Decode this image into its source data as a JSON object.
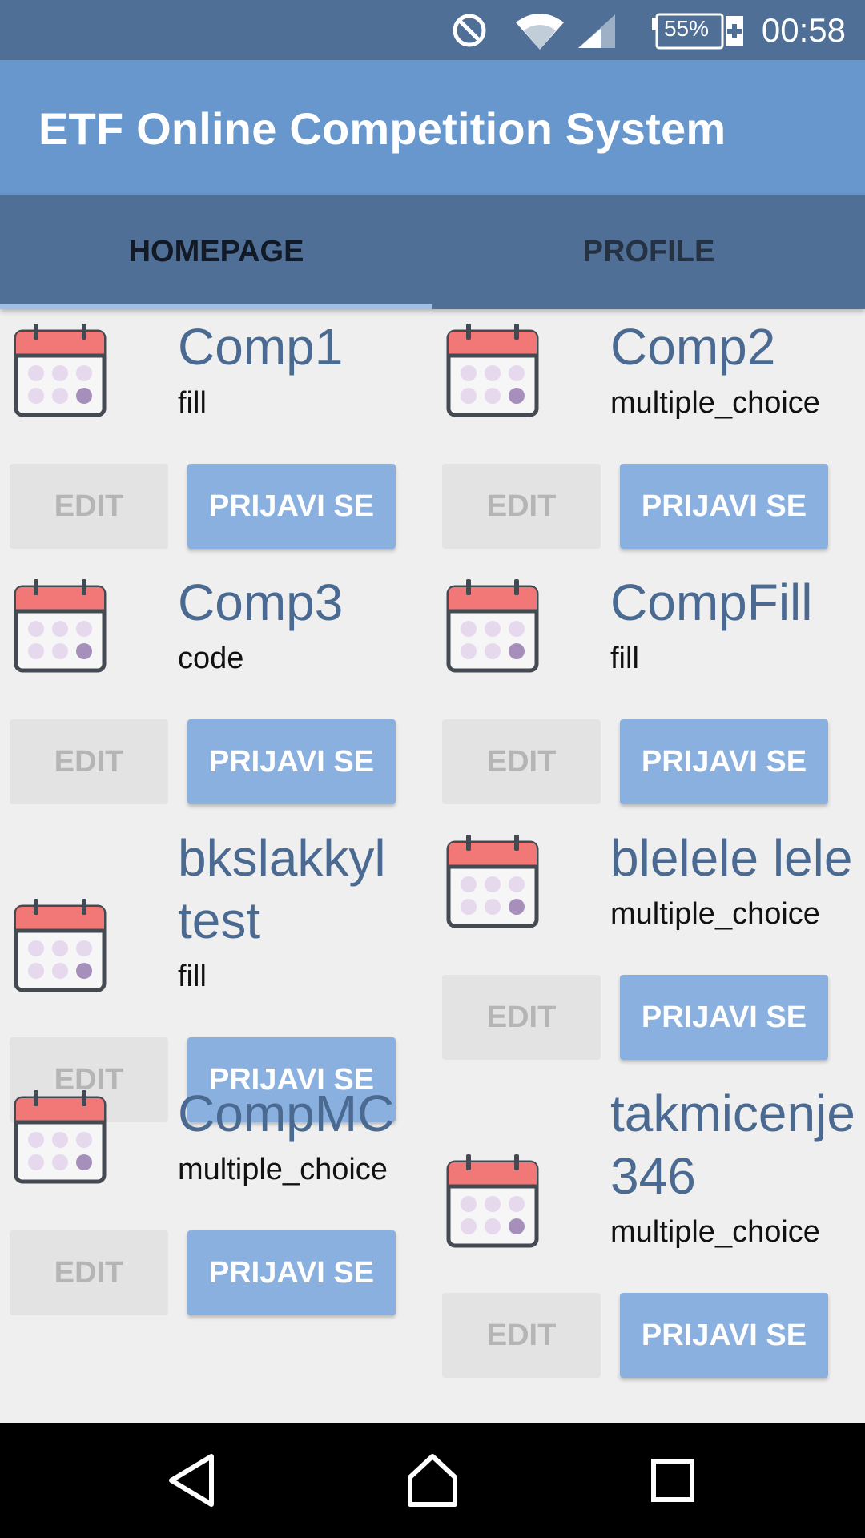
{
  "status_bar": {
    "time": "00:58",
    "battery": "55%",
    "icons": [
      "dnd-icon",
      "wifi-icon",
      "signal-icon",
      "battery-icon"
    ]
  },
  "app": {
    "title": "ETF Online Competition System",
    "accent": "#6797cd",
    "tabbar_color": "#4f6f96"
  },
  "tabs": [
    {
      "label": "HOMEPAGE",
      "active": true
    },
    {
      "label": "PROFILE",
      "active": false
    }
  ],
  "competitions": [
    {
      "name": "Comp1",
      "type": "fill",
      "edit_label": "EDIT",
      "join_label": "PRIJAVI SE"
    },
    {
      "name": "Comp2",
      "type": "multiple_choice",
      "edit_label": "EDIT",
      "join_label": "PRIJAVI SE"
    },
    {
      "name": "Comp3",
      "type": "code",
      "edit_label": "EDIT",
      "join_label": "PRIJAVI SE"
    },
    {
      "name": "CompFill",
      "type": "fill",
      "edit_label": "EDIT",
      "join_label": "PRIJAVI SE"
    },
    {
      "name": "bkslakkyl test",
      "type": "fill",
      "edit_label": "EDIT",
      "join_label": "PRIJAVI SE"
    },
    {
      "name": "blelele lele",
      "type": "multiple_choice",
      "edit_label": "EDIT",
      "join_label": "PRIJAVI SE"
    },
    {
      "name": "CompMC",
      "type": "multiple_choice",
      "edit_label": "EDIT",
      "join_label": "PRIJAVI SE"
    },
    {
      "name": "takmicenje346",
      "type": "multiple_choice",
      "edit_label": "EDIT",
      "join_label": "PRIJAVI SE"
    }
  ],
  "nav": {
    "icons": [
      "back-icon",
      "home-icon",
      "recents-icon"
    ]
  }
}
